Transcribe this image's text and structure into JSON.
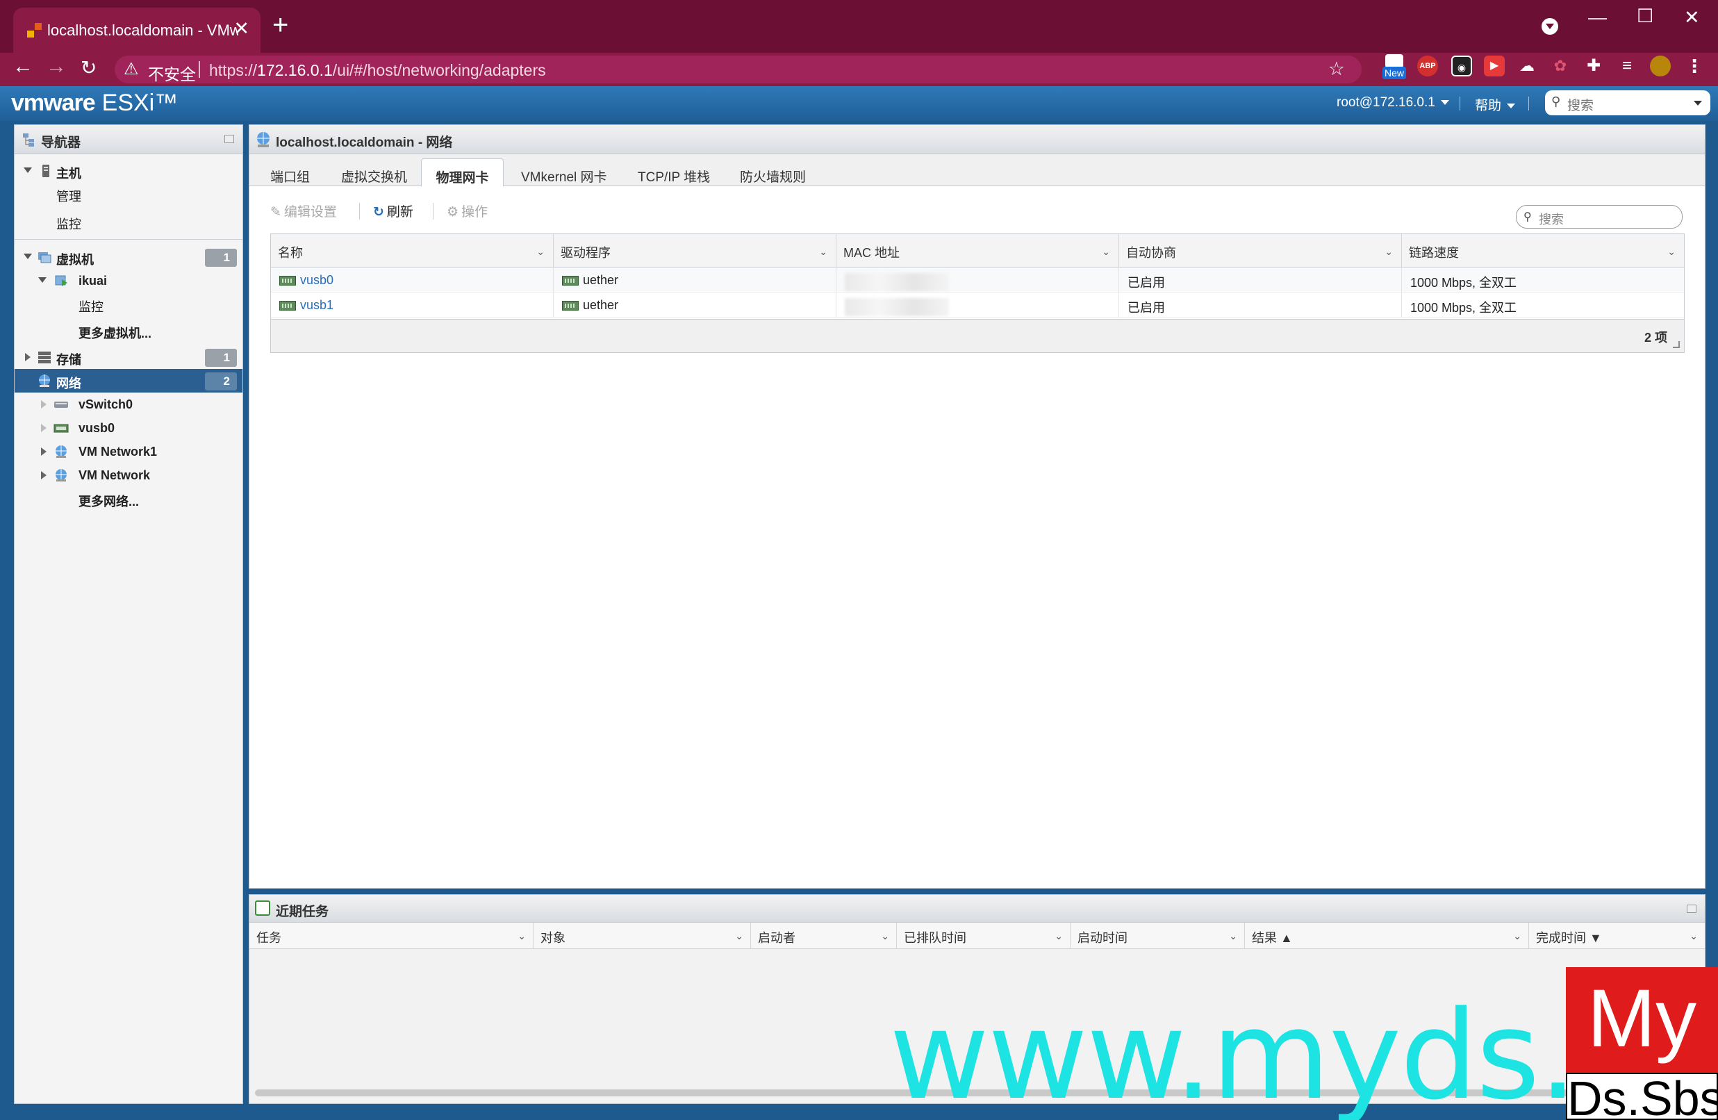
{
  "browser": {
    "tab_title": "localhost.localdomain - VMwa",
    "insecure_label": "不安全",
    "url_prefix": "https://",
    "url_host": "172.16.0.1",
    "url_path": "/ui/#/host/networking/adapters",
    "ext_new_label": "New",
    "ext_abp_label": "ABP"
  },
  "esxi": {
    "logo_vm": "vmware",
    "logo_product": "ESXi™",
    "user": "root@172.16.0.1",
    "help": "帮助",
    "search_placeholder": "搜索"
  },
  "navigator": {
    "title": "导航器",
    "items": [
      {
        "label": "主机",
        "bold": true
      },
      {
        "label": "管理"
      },
      {
        "label": "监控"
      },
      {
        "label": "虚拟机",
        "bold": true,
        "badge": "1"
      },
      {
        "label": "ikuai",
        "bold": true
      },
      {
        "label": "监控"
      },
      {
        "label": "更多虚拟机..."
      },
      {
        "label": "存储",
        "bold": true,
        "badge": "1"
      },
      {
        "label": "网络",
        "bold": true,
        "badge": "2"
      },
      {
        "label": "vSwitch0"
      },
      {
        "label": "vusb0"
      },
      {
        "label": "VM Network1"
      },
      {
        "label": "VM Network"
      },
      {
        "label": "更多网络..."
      }
    ]
  },
  "main": {
    "title": "localhost.localdomain - 网络",
    "tabs": [
      "端口组",
      "虚拟交换机",
      "物理网卡",
      "VMkernel 网卡",
      "TCP/IP 堆栈",
      "防火墙规则"
    ],
    "active_tab": "物理网卡",
    "toolbar": {
      "edit": "编辑设置",
      "refresh": "刷新",
      "actions": "操作"
    },
    "search_placeholder": "搜索",
    "columns": [
      "名称",
      "驱动程序",
      "MAC 地址",
      "自动协商",
      "链路速度"
    ],
    "rows": [
      {
        "name": "vusb0",
        "driver": "uether",
        "mac": "",
        "autoneg": "已启用",
        "speed": "1000 Mbps, 全双工"
      },
      {
        "name": "vusb1",
        "driver": "uether",
        "mac": "",
        "autoneg": "已启用",
        "speed": "1000 Mbps, 全双工"
      }
    ],
    "count": "2 项"
  },
  "tasks": {
    "title": "近期任务",
    "columns": [
      "任务",
      "对象",
      "启动者",
      "已排队时间",
      "启动时间",
      "结果 ▲",
      "完成时间 ▼"
    ]
  },
  "watermark": {
    "url": "www.myds.sbs",
    "box_top": "My",
    "box_bottom": "Ds.Sbs"
  }
}
